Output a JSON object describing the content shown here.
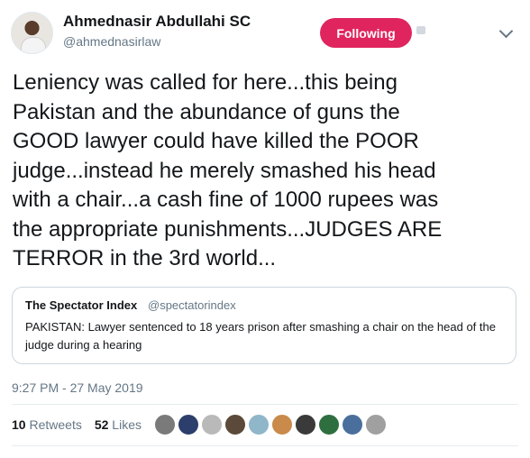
{
  "author": {
    "name": "Ahmednasir Abdullahi SC",
    "handle": "@ahmednasirlaw"
  },
  "follow_button": {
    "label": "Following"
  },
  "tweet": {
    "text": "Leniency was called for here...this being\nPakistan and the abundance of guns the\nGOOD lawyer could have killed the POOR\njudge...instead he merely smashed his head\nwith a chair...a cash fine of 1000 rupees was\nthe appropriate punishments...JUDGES ARE\nTERROR in the 3rd world..."
  },
  "quoted_tweet": {
    "name": "The Spectator Index",
    "handle": "@spectatorindex",
    "text": "PAKISTAN: Lawyer sentenced to 18 years prison after smashing a chair on the head of the judge during a hearing"
  },
  "timestamp": "9:27 PM - 27 May 2019",
  "stats": {
    "retweets_count": "10",
    "retweets_label": "Retweets",
    "likes_count": "52",
    "likes_label": "Likes"
  },
  "colors": {
    "following_button": "#e0245e",
    "secondary_text": "#657786"
  },
  "icons": [
    "notification-settings-icon",
    "chevron-down-icon"
  ]
}
